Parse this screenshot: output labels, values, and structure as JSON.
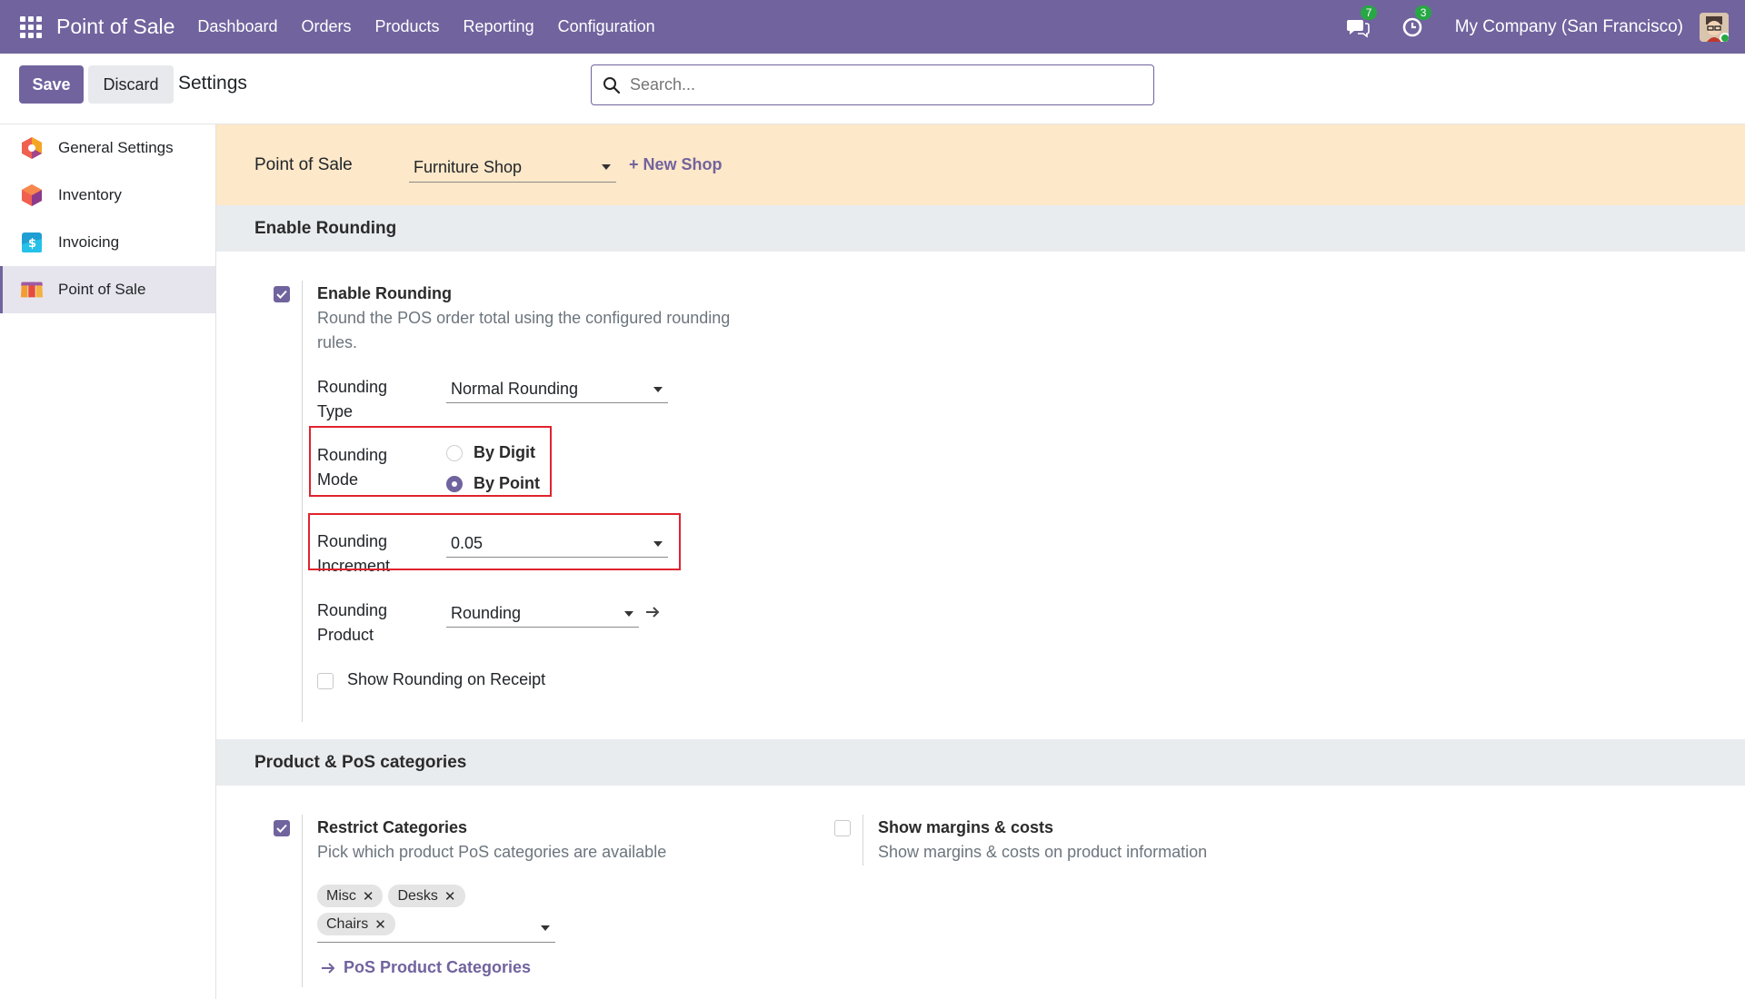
{
  "navbar": {
    "app_name": "Point of Sale",
    "menu": [
      "Dashboard",
      "Orders",
      "Products",
      "Reporting",
      "Configuration"
    ],
    "messages_count": "7",
    "activities_count": "3",
    "company": "My Company (San Francisco)"
  },
  "control": {
    "save_label": "Save",
    "discard_label": "Discard",
    "title": "Settings",
    "search_placeholder": "Search..."
  },
  "sidebar": {
    "items": [
      {
        "label": "General Settings",
        "icon": "general-settings-icon"
      },
      {
        "label": "Inventory",
        "icon": "inventory-icon"
      },
      {
        "label": "Invoicing",
        "icon": "invoicing-icon"
      },
      {
        "label": "Point of Sale",
        "icon": "point-of-sale-icon",
        "active": true
      }
    ]
  },
  "pos_banner": {
    "label": "Point of Sale",
    "shop": "Furniture Shop",
    "new_shop": "+ New Shop"
  },
  "rounding": {
    "section_title": "Enable Rounding",
    "enable_title": "Enable Rounding",
    "enable_checked": true,
    "enable_desc_1": "Round the POS order total using the configured rounding",
    "enable_desc_2": "rules.",
    "type_label_1": "Rounding",
    "type_label_2": "Type",
    "type_value": "Normal Rounding",
    "mode_label_1": "Rounding",
    "mode_label_2": "Mode",
    "mode_options": [
      {
        "label": "By Digit",
        "selected": false
      },
      {
        "label": "By Point",
        "selected": true
      }
    ],
    "increment_label_1": "Rounding",
    "increment_label_2": "Increment",
    "increment_value": "0.05",
    "product_label_1": "Rounding",
    "product_label_2": "Product",
    "product_value": "Rounding",
    "show_on_receipt_label": "Show Rounding on Receipt",
    "show_on_receipt_checked": false
  },
  "categories": {
    "section_title": "Product & PoS categories",
    "restrict_title": "Restrict Categories",
    "restrict_checked": true,
    "restrict_desc": "Pick which product PoS categories are available",
    "tags": [
      "Misc",
      "Desks",
      "Chairs"
    ],
    "link_label": "PoS Product Categories",
    "margins_title": "Show margins & costs",
    "margins_checked": false,
    "margins_desc": "Show margins & costs on product information"
  },
  "colors": {
    "brand": "#71639e",
    "banner": "#fde8c9",
    "section": "#e9ecef",
    "highlight": "#e0232e",
    "badge": "#28a745"
  }
}
